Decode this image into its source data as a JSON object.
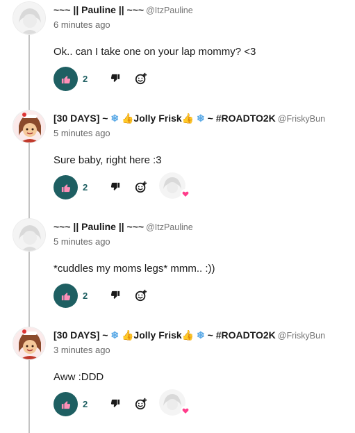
{
  "comments": [
    {
      "user": {
        "name": "~~~ || Pauline || ~~~",
        "handle": "@ItzPauline"
      },
      "timestamp": "6 minutes ago",
      "text": "Ok.. can I take one on your lap mommy? <3",
      "likes": "2"
    },
    {
      "user": {
        "name_parts": [
          "[30 DAYS] ~ ",
          "❄",
          " 👍Jolly Frisk👍 ",
          "❄",
          " ~ #ROADTO2K"
        ],
        "handle": "@FriskyBun"
      },
      "timestamp": "5 minutes ago",
      "text": "Sure baby, right here :3",
      "likes": "2"
    },
    {
      "user": {
        "name": "~~~ || Pauline || ~~~",
        "handle": "@ItzPauline"
      },
      "timestamp": "5 minutes ago",
      "text": "*cuddles my moms legs* mmm.. :))",
      "likes": "2"
    },
    {
      "user": {
        "name_parts": [
          "[30 DAYS] ~ ",
          "❄",
          " 👍Jolly Frisk👍 ",
          "❄",
          " ~ #ROADTO2K"
        ],
        "handle": "@FriskyBun"
      },
      "timestamp": "3 minutes ago",
      "text": "Aww :DDD",
      "likes": "2"
    }
  ],
  "colors": {
    "like_button": "#1e5f62",
    "like_count": "#1e5f62",
    "heart": "#ff3d8b",
    "snowflake": "#5aa9e6"
  },
  "icons": {
    "like": "thumbs-up-icon",
    "dislike": "thumbs-down-icon",
    "react": "add-reaction-icon",
    "heart": "heart-icon"
  }
}
